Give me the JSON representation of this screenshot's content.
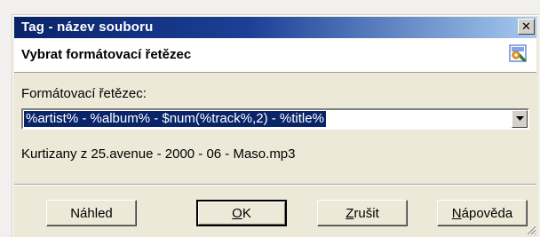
{
  "window": {
    "title": "Tag - název souboru",
    "close_symbol": "✕"
  },
  "header": {
    "title": "Vybrat formátovací řetězec",
    "icon": "format-string-icon"
  },
  "form": {
    "label": "Formátovací řetězec:",
    "format_value": "%artist% - %album% - $num(%track%,2) - %title%"
  },
  "preview": {
    "text": "Kurtizany z 25.avenue - 2000 - 06 - Maso.mp3"
  },
  "buttons": {
    "preview_label": "Náhled",
    "ok_first": "O",
    "ok_rest": "K",
    "cancel_first": "Z",
    "cancel_rest": "rušit",
    "help_first": "N",
    "help_rest": "ápověda"
  },
  "colors": {
    "titlebar_start": "#0a246a",
    "titlebar_end": "#a6caf0",
    "selection": "#0a246a",
    "dialog_bg": "#ece9d8"
  }
}
